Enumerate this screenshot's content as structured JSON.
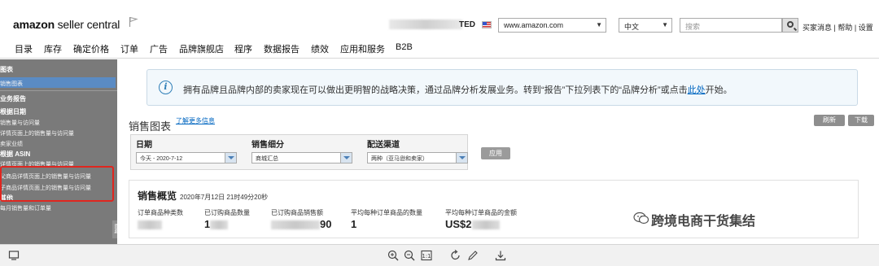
{
  "header": {
    "logo_bold": "amazon",
    "logo_rest": " seller central",
    "account_suffix": "TED",
    "marketplace": "www.amazon.com",
    "language": "中文",
    "search_placeholder": "搜索",
    "links": [
      "买家消息",
      "帮助",
      "设置"
    ]
  },
  "nav": {
    "items": [
      "目录",
      "库存",
      "确定价格",
      "订单",
      "广告",
      "品牌旗舰店",
      "程序",
      "数据报告",
      "绩效",
      "应用和服务",
      "B2B"
    ]
  },
  "sidebar": {
    "lines": [
      {
        "text": "图表",
        "bold": true
      },
      {
        "text": "销售图表",
        "bold": false
      },
      {
        "text": "业务报告",
        "bold": true
      },
      {
        "text": "根据日期",
        "bold": true
      },
      {
        "text": "销售量与访问量",
        "bold": false
      },
      {
        "text": "详情页面上的销售量与访问量",
        "bold": false
      },
      {
        "text": "卖家业绩",
        "bold": false
      },
      {
        "text": "根据 ASIN",
        "bold": true
      },
      {
        "text": "详情页面上的销售量与访问量",
        "bold": false
      },
      {
        "text": "父商品详情页面上的销售量与访问量",
        "bold": false
      },
      {
        "text": "子商品详情页面上的销售量与访问量",
        "bold": false
      },
      {
        "text": "其他",
        "bold": true
      },
      {
        "text": "每月销售量和订单量",
        "bold": false
      }
    ],
    "tab_label": "隐藏"
  },
  "banner": {
    "text": "拥有品牌且品牌内部的卖家现在可以做出更明智的战略决策，通过品牌分析发展业务。转到“报告”下拉列表下的“品牌分析”或点击",
    "link": "此处",
    "suffix": "开始。"
  },
  "sales_chart": {
    "title": "销售图表",
    "learn_more": "了解更多信息",
    "refresh": "刷新",
    "download": "下载"
  },
  "filters": {
    "date_label": "日期",
    "date_value": "今天 - 2020-7-12",
    "category_label": "销售细分",
    "category_value": "商城汇总",
    "channel_label": "配送渠道",
    "channel_value": "两种（亚马逊和卖家）",
    "apply": "应用"
  },
  "overview": {
    "title": "销售概览",
    "timestamp": "2020年7月12日 21时49分20秒",
    "metrics": [
      {
        "label": "订单商品种类数",
        "value": ""
      },
      {
        "label": "已订购商品数量",
        "value": "1"
      },
      {
        "label": "已订购商品销售额",
        "value": "90"
      },
      {
        "label": "平均每种订单商品的数量",
        "value": "1"
      },
      {
        "label": "平均每种订单商品的金额",
        "value": "US$2"
      }
    ]
  },
  "watermark": "跨境电商干货集结"
}
